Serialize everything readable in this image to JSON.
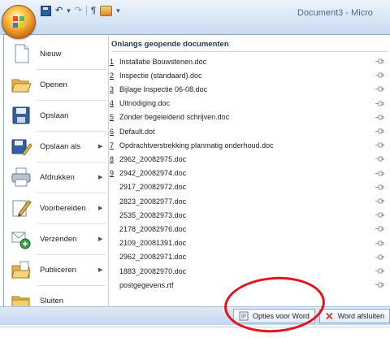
{
  "window": {
    "title": "Document3 - Micro"
  },
  "menu": {
    "items": [
      {
        "label": "Nieuw",
        "icon": "new-document-icon",
        "has_submenu": false
      },
      {
        "label": "Openen",
        "icon": "open-folder-icon",
        "has_submenu": false
      },
      {
        "label": "Opslaan",
        "icon": "save-disk-icon",
        "has_submenu": false
      },
      {
        "label": "Opslaan als",
        "icon": "save-as-icon",
        "has_submenu": true
      },
      {
        "label": "Afdrukken",
        "icon": "printer-icon",
        "has_submenu": true
      },
      {
        "label": "Voorbereiden",
        "icon": "pencil-prepare-icon",
        "has_submenu": true
      },
      {
        "label": "Verzenden",
        "icon": "send-icon",
        "has_submenu": true
      },
      {
        "label": "Publiceren",
        "icon": "publish-icon",
        "has_submenu": true
      },
      {
        "label": "Sluiten",
        "icon": "close-folder-icon",
        "has_submenu": false
      }
    ]
  },
  "recent": {
    "title": "Onlangs geopende documenten",
    "documents": [
      {
        "num": "1",
        "name": "Installatie Bouwstenen.doc"
      },
      {
        "num": "2",
        "name": "Inspectie (standaard).doc"
      },
      {
        "num": "3",
        "name": "Bijlage Inspectie 06-08.doc"
      },
      {
        "num": "4",
        "name": "Uitnodiging.doc"
      },
      {
        "num": "5",
        "name": "Zonder begeleidend schrijven.doc"
      },
      {
        "num": "6",
        "name": "Default.dot"
      },
      {
        "num": "7",
        "name": "Opdrachtverstrekking planmatig onderhoud.doc"
      },
      {
        "num": "8",
        "name": "2962_20082975.doc"
      },
      {
        "num": "9",
        "name": "2942_20082974.doc"
      },
      {
        "num": "",
        "name": "2917_20082972.doc"
      },
      {
        "num": "",
        "name": "2823_20082977.doc"
      },
      {
        "num": "",
        "name": "2535_20082973.doc"
      },
      {
        "num": "",
        "name": "2178_20082976.doc"
      },
      {
        "num": "",
        "name": "2109_20081391.doc"
      },
      {
        "num": "",
        "name": "2962_20082971.doc"
      },
      {
        "num": "",
        "name": "1883_20082970.doc"
      },
      {
        "num": "",
        "name": "postgegevens.rtf"
      }
    ]
  },
  "footer": {
    "options_label": "Opties voor Word",
    "exit_label": "Word afsluiten"
  },
  "colors": {
    "accent": "#1e395b",
    "annotation_red": "#e3141c"
  }
}
